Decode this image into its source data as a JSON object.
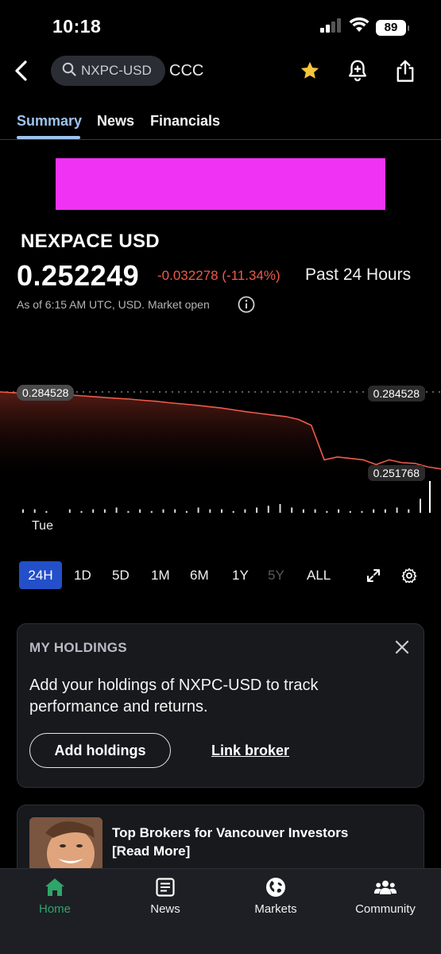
{
  "status_bar": {
    "time": "10:18",
    "battery": "89"
  },
  "header": {
    "search_value": "NXPC-USD",
    "provider": "CCC",
    "icons": [
      "back-icon",
      "search-icon",
      "star-icon",
      "alert-add-icon",
      "share-icon"
    ]
  },
  "tabs": [
    {
      "label": "Summary",
      "active": true
    },
    {
      "label": "News"
    },
    {
      "label": "Financials"
    }
  ],
  "quote": {
    "name": "NEXPACE USD",
    "price": "0.252249",
    "change": "-0.032278 (-11.34%)",
    "period": "Past 24 Hours",
    "as_of": "As of 6:15 AM UTC, USD. Market open"
  },
  "chart_data": {
    "type": "line",
    "title": "",
    "xlabel": "",
    "ylabel": "",
    "x_tick_labels": [
      "Tue"
    ],
    "start_label": "0.284528",
    "high_label": "0.284528",
    "low_label": "0.251768",
    "series": [
      {
        "values": [
          0.2845,
          0.2842,
          0.2838,
          0.2841,
          0.2837,
          0.2833,
          0.283,
          0.2826,
          0.2822,
          0.2818,
          0.2815,
          0.281,
          0.2806,
          0.28,
          0.2795,
          0.279,
          0.2784,
          0.2778,
          0.277,
          0.2762,
          0.2755,
          0.2748,
          0.2742,
          0.273,
          0.2705,
          0.256,
          0.2572,
          0.2566,
          0.256,
          0.254,
          0.256,
          0.2548,
          0.2545,
          0.253,
          0.2522
        ]
      }
    ],
    "volume": [
      2,
      2,
      1,
      0,
      2,
      1,
      2,
      2,
      3,
      1,
      2,
      1,
      2,
      2,
      1,
      3,
      2,
      2,
      1,
      2,
      3,
      4,
      5,
      3,
      2,
      2,
      1,
      2,
      1,
      1,
      2,
      2,
      3,
      2,
      8
    ],
    "colors": {
      "line": "#ee5b4c",
      "fill_top": "#5a1d16",
      "fill_bottom": "#000000"
    }
  },
  "ranges": [
    {
      "label": "24H",
      "active": true
    },
    {
      "label": "1D"
    },
    {
      "label": "5D"
    },
    {
      "label": "1M"
    },
    {
      "label": "6M"
    },
    {
      "label": "1Y"
    },
    {
      "label": "5Y",
      "disabled": true
    },
    {
      "label": "ALL"
    }
  ],
  "holdings": {
    "title": "MY HOLDINGS",
    "text": "Add your holdings of NXPC-USD to track performance and returns.",
    "add_button": "Add holdings",
    "link_button": "Link broker"
  },
  "promo": {
    "title": "Top Brokers for Vancouver Investors [Read More]"
  },
  "bottom_nav": [
    {
      "label": "Home",
      "icon": "home-icon",
      "active": true
    },
    {
      "label": "News",
      "icon": "news-icon"
    },
    {
      "label": "Markets",
      "icon": "globe-icon"
    },
    {
      "label": "Community",
      "icon": "community-icon"
    }
  ],
  "colors": {
    "accent": "#2350c8",
    "negative": "#ef5a4c",
    "tab_active": "#9ec3ec",
    "home_active": "#2fa56a",
    "ad": "#ef32f3"
  }
}
